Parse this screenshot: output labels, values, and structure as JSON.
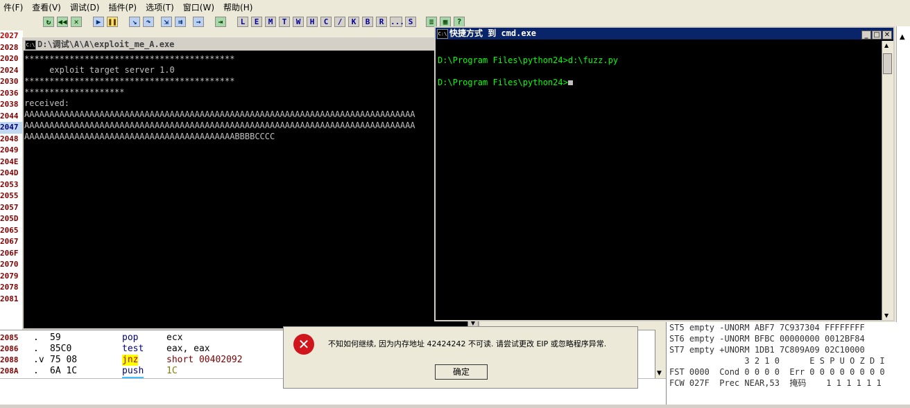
{
  "menu": [
    "件(F)",
    "查看(V)",
    "调试(D)",
    "插件(P)",
    "选项(T)",
    "窗口(W)",
    "帮助(H)"
  ],
  "toolbar_letters": [
    "L",
    "E",
    "M",
    "T",
    "W",
    "H",
    "C",
    "/",
    "K",
    "B",
    "R",
    "...",
    "S"
  ],
  "gutter_lines": [
    "2027",
    "2028",
    "2020",
    "2024",
    "2030",
    "2036",
    "2038",
    "2044",
    "2047",
    "2048",
    "2049",
    "204E",
    "204D",
    "2053",
    "2055",
    "2057",
    "205D",
    "2065",
    "2067",
    "206F",
    "2070",
    "2079",
    "2078",
    "2081"
  ],
  "cpu_rows": [
    {
      "addr": "2085",
      "mark": ".",
      "hex": "59",
      "mnemonic": "pop",
      "operand": "ecx"
    },
    {
      "addr": "2086",
      "mark": ".",
      "hex": "85C0",
      "mnemonic": "test",
      "operand": "eax, eax"
    },
    {
      "addr": "2088",
      "mark": ".v",
      "hex": "75 08",
      "mnemonic": "jnz",
      "operand": "short 00402092"
    },
    {
      "addr": "208A",
      "mark": ".",
      "hex": "6A 1C",
      "mnemonic": "push",
      "operand": "1C"
    }
  ],
  "fpu": [
    "ST5 empty -UNORM ABF7 7C937304 FFFFFFFF",
    "ST6 empty -UNORM BFBC 00000000 0012BF84",
    "ST7 empty +UNORM 1DB1 7C809A09 02C10000",
    "               3 2 1 0      E S P U O Z D I",
    "FST 0000  Cond 0 0 0 0  Err 0 0 0 0 0 0 0 0",
    "FCW 027F  Prec NEAR,53  掩码    1 1 1 1 1 1"
  ],
  "exploit_window": {
    "title": "D:\\调试\\A\\A\\exploit_me_A.exe",
    "lines": [
      "******************************************",
      "     exploit target server 1.0",
      "******************************************",
      "********************",
      "received:",
      "AAAAAAAAAAAAAAAAAAAAAAAAAAAAAAAAAAAAAAAAAAAAAAAAAAAAAAAAAAAAAAAAAAAAAAAAAAAAAA",
      "AAAAAAAAAAAAAAAAAAAAAAAAAAAAAAAAAAAAAAAAAAAAAAAAAAAAAAAAAAAAAAAAAAAAAAAAAAAAAA",
      "AAAAAAAAAAAAAAAAAAAAAAAAAAAAAAAAAAAAAAAAAABBBBCCCC"
    ]
  },
  "cmd_window": {
    "title": "快捷方式 到 cmd.exe",
    "lines": [
      "",
      "D:\\Program Files\\python24>d:\\fuzz.py",
      "",
      "D:\\Program Files\\python24>"
    ]
  },
  "dialog": {
    "message": "不知如何继续, 因为内存地址 42424242 不可读. 请尝试更改 EIP 或忽略程序异常.",
    "ok_label": "确定"
  },
  "colors": {
    "console_text": "#c0c0c0",
    "cmd_text": "#00ff00",
    "titlebar_active": "#0a246a",
    "titlebar_inactive": "#d4d0c8"
  }
}
